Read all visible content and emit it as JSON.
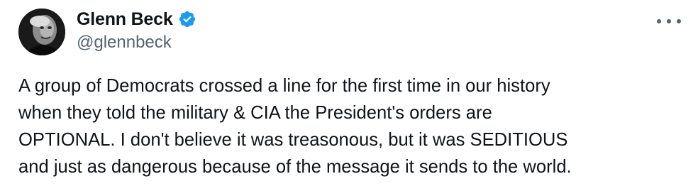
{
  "author": {
    "display_name": "Glenn Beck",
    "handle": "@glennbeck",
    "verified": true
  },
  "tweet": {
    "text": "A group of Democrats crossed a line for the first time in our history\nwhen they told the military & CIA the President's orders are\nOPTIONAL. I don't believe it was treasonous, but it was SEDITIOUS\nand just as dangerous because of the message it sends to the world."
  },
  "icons": {
    "verified": "verified-badge-icon",
    "more": "more-options-icon"
  },
  "colors": {
    "text_primary": "#0f1419",
    "text_secondary": "#536471",
    "verified_blue": "#1d9bf0"
  }
}
